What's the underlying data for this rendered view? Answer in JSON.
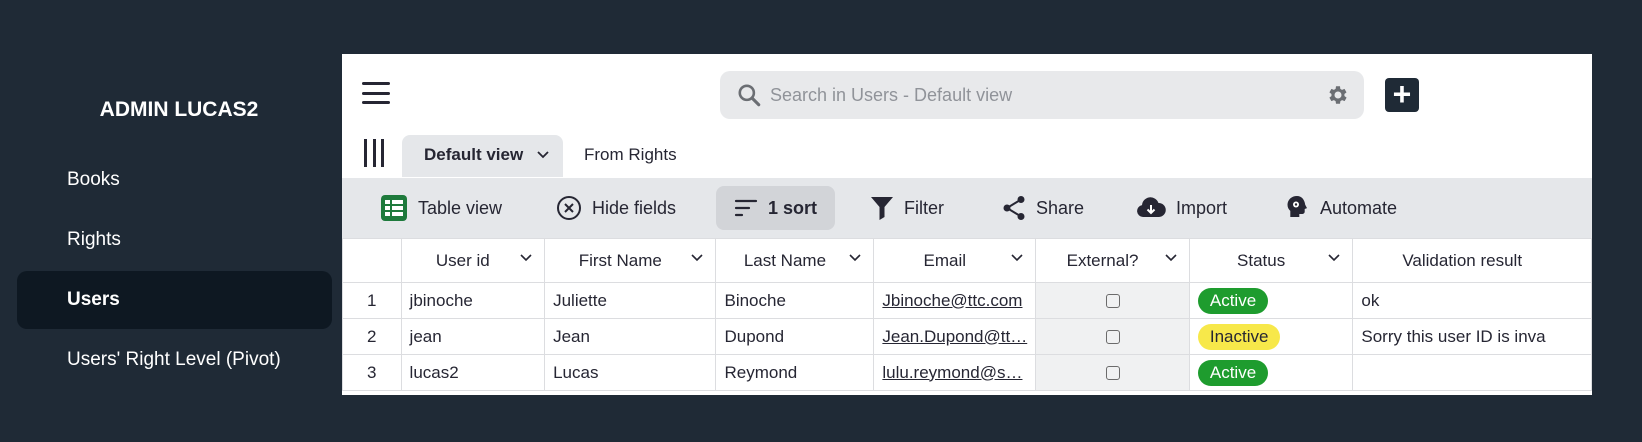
{
  "sidebar": {
    "app_title": "ADMIN LUCAS2",
    "items": [
      {
        "label": "Books",
        "active": false
      },
      {
        "label": "Rights",
        "active": false
      },
      {
        "label": "Users",
        "active": true
      },
      {
        "label": "Users' Right Level (Pivot)",
        "active": false
      }
    ]
  },
  "header": {
    "search_placeholder": "Search in Users - Default view",
    "add_label": "+"
  },
  "tabs": [
    {
      "label": "Default view",
      "active": true
    },
    {
      "label": "From Rights",
      "active": false
    }
  ],
  "toolbar": {
    "table_view": "Table view",
    "hide_fields": "Hide fields",
    "sort": "1 sort",
    "filter": "Filter",
    "share": "Share",
    "import": "Import",
    "automate": "Automate"
  },
  "table": {
    "columns": [
      "User id",
      "First Name",
      "Last Name",
      "Email",
      "External?",
      "Status",
      "Validation result"
    ],
    "rows": [
      {
        "num": "1",
        "user_id": "jbinoche",
        "first": "Juliette",
        "last": "Binoche",
        "email": "Jbinoche@ttc.com",
        "external": false,
        "status": "Active",
        "validation": "ok"
      },
      {
        "num": "2",
        "user_id": "jean",
        "first": "Jean",
        "last": "Dupond",
        "email": "Jean.Dupond@tt…",
        "external": false,
        "status": "Inactive",
        "validation": "Sorry this user ID is inva"
      },
      {
        "num": "3",
        "user_id": "lucas2",
        "first": "Lucas",
        "last": "Reymond",
        "email": "lulu.reymond@s…",
        "external": false,
        "status": "Active",
        "validation": ""
      }
    ]
  },
  "colors": {
    "background": "#1f2a36",
    "active_nav": "#0e1822",
    "status_active": "#1e9c2e",
    "status_inactive": "#f7e84a",
    "table_view_icon": "#1e7a3c"
  }
}
